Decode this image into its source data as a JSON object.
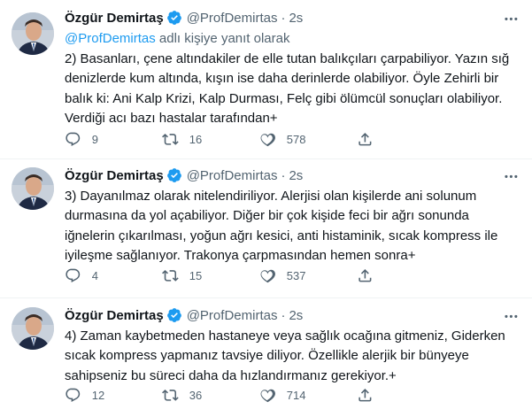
{
  "tweets": [
    {
      "author_name": "Özgür Demirtaş",
      "author_handle": "@ProfDemirtas",
      "separator": "·",
      "time": "2s",
      "replying_handle": "@ProfDemirtas",
      "replying_suffix": " adlı kişiye yanıt olarak",
      "lines": [
        "2) Basanları, çene altındakiler de elle tutan balıkçıları çarpabiliyor. Yazın sığ",
        "denizlerde kum altında, kışın ise daha derinlerde olabiliyor. Öyle Zehirli bir",
        "balık ki: Ani Kalp Krizi, Kalp Durması, Felç gibi ölümcül sonuçları olabiliyor.",
        "Verdiği acı bazı hastalar tarafından+"
      ],
      "replies": "9",
      "retweets": "16",
      "likes": "578"
    },
    {
      "author_name": "Özgür Demirtaş",
      "author_handle": "@ProfDemirtas",
      "separator": "·",
      "time": "2s",
      "lines": [
        "3) Dayanılmaz olarak nitelendiriliyor. Alerjisi olan kişilerde ani solunum",
        "durmasına da yol açabiliyor. Diğer bir çok kişide feci bir ağrı sonunda",
        "iğnelerin çıkarılması, yoğun ağrı kesici, anti histaminik, sıcak kompress ile",
        "iyileşme sağlanıyor. Trakonya çarpmasından hemen sonra+"
      ],
      "replies": "4",
      "retweets": "15",
      "likes": "537"
    },
    {
      "author_name": "Özgür Demirtaş",
      "author_handle": "@ProfDemirtas",
      "separator": "·",
      "time": "2s",
      "lines": [
        "4) Zaman kaybetmeden hastaneye veya sağlık ocağına gitmeniz, Giderken",
        "sıcak kompress yapmanız tavsiye diliyor. Özellikle alerjik bir bünyeye",
        "sahipseniz bu süreci daha da hızlandırmanız gerekiyor.+"
      ],
      "replies": "12",
      "retweets": "36",
      "likes": "714"
    }
  ],
  "colors": {
    "link": "#1d9bf0",
    "text": "#0f1419",
    "secondary": "#536471",
    "verified": "#1d9bf0"
  },
  "icons": [
    "verified-badge-icon",
    "more-icon",
    "reply-icon",
    "retweet-icon",
    "like-icon",
    "share-icon"
  ]
}
